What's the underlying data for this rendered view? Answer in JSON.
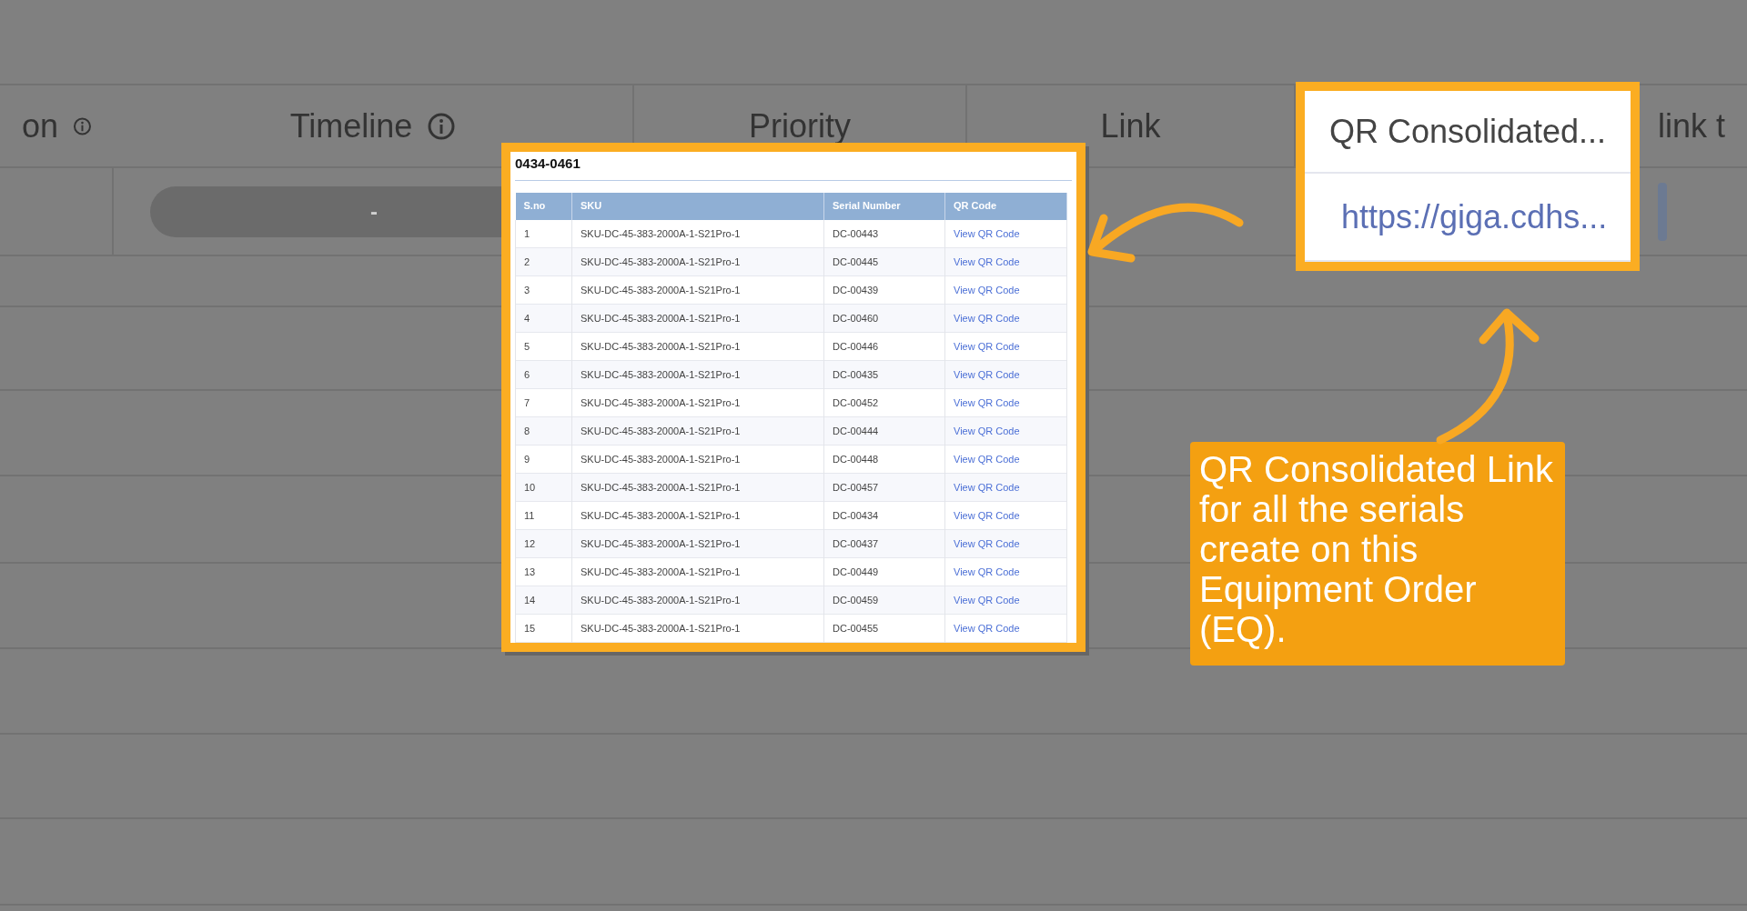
{
  "background_table": {
    "columns": [
      {
        "label": "on",
        "info_icon": true,
        "highlighted": false,
        "cell": {
          "kind": "empty"
        }
      },
      {
        "label": "Timeline",
        "info_icon": true,
        "highlighted": false,
        "cell": {
          "kind": "pill",
          "text": "-"
        }
      },
      {
        "label": "Priority",
        "info_icon": false,
        "highlighted": false,
        "cell": {
          "kind": "empty"
        }
      },
      {
        "label": "Link",
        "info_icon": false,
        "highlighted": false,
        "cell": {
          "kind": "empty"
        }
      },
      {
        "label": "QR Consolidated...",
        "info_icon": false,
        "highlighted": true,
        "cell": {
          "kind": "link",
          "text": "https://giga.cdhs..."
        }
      },
      {
        "label": "link t",
        "highlighted": false,
        "cell": {
          "kind": "bar"
        }
      }
    ]
  },
  "popup": {
    "title": "0434-0461",
    "columns": [
      "S.no",
      "SKU",
      "Serial Number",
      "QR Code"
    ],
    "rows": [
      {
        "sno": "1",
        "sku": "SKU-DC-45-383-2000A-1-S21Pro-1",
        "serial": "DC-00443",
        "qr": "View QR Code"
      },
      {
        "sno": "2",
        "sku": "SKU-DC-45-383-2000A-1-S21Pro-1",
        "serial": "DC-00445",
        "qr": "View QR Code"
      },
      {
        "sno": "3",
        "sku": "SKU-DC-45-383-2000A-1-S21Pro-1",
        "serial": "DC-00439",
        "qr": "View QR Code"
      },
      {
        "sno": "4",
        "sku": "SKU-DC-45-383-2000A-1-S21Pro-1",
        "serial": "DC-00460",
        "qr": "View QR Code"
      },
      {
        "sno": "5",
        "sku": "SKU-DC-45-383-2000A-1-S21Pro-1",
        "serial": "DC-00446",
        "qr": "View QR Code"
      },
      {
        "sno": "6",
        "sku": "SKU-DC-45-383-2000A-1-S21Pro-1",
        "serial": "DC-00435",
        "qr": "View QR Code"
      },
      {
        "sno": "7",
        "sku": "SKU-DC-45-383-2000A-1-S21Pro-1",
        "serial": "DC-00452",
        "qr": "View QR Code"
      },
      {
        "sno": "8",
        "sku": "SKU-DC-45-383-2000A-1-S21Pro-1",
        "serial": "DC-00444",
        "qr": "View QR Code"
      },
      {
        "sno": "9",
        "sku": "SKU-DC-45-383-2000A-1-S21Pro-1",
        "serial": "DC-00448",
        "qr": "View QR Code"
      },
      {
        "sno": "10",
        "sku": "SKU-DC-45-383-2000A-1-S21Pro-1",
        "serial": "DC-00457",
        "qr": "View QR Code"
      },
      {
        "sno": "11",
        "sku": "SKU-DC-45-383-2000A-1-S21Pro-1",
        "serial": "DC-00434",
        "qr": "View QR Code"
      },
      {
        "sno": "12",
        "sku": "SKU-DC-45-383-2000A-1-S21Pro-1",
        "serial": "DC-00437",
        "qr": "View QR Code"
      },
      {
        "sno": "13",
        "sku": "SKU-DC-45-383-2000A-1-S21Pro-1",
        "serial": "DC-00449",
        "qr": "View QR Code"
      },
      {
        "sno": "14",
        "sku": "SKU-DC-45-383-2000A-1-S21Pro-1",
        "serial": "DC-00459",
        "qr": "View QR Code"
      },
      {
        "sno": "15",
        "sku": "SKU-DC-45-383-2000A-1-S21Pro-1",
        "serial": "DC-00455",
        "qr": "View QR Code"
      }
    ]
  },
  "callout": {
    "text": "QR Consolidated Link for all the serials create on this Equipment Order (EQ)."
  }
}
